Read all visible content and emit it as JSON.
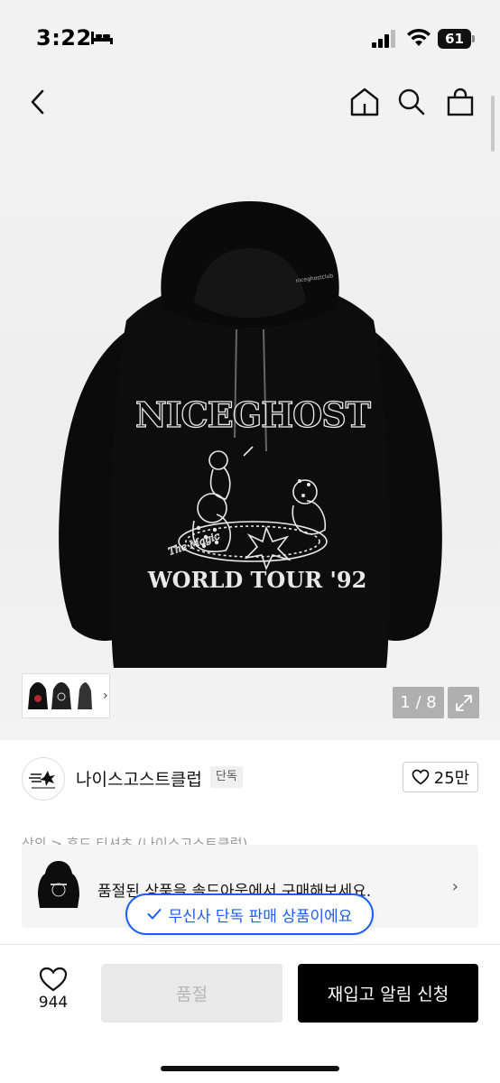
{
  "status_bar": {
    "time": "3:22",
    "battery_level": "61",
    "icons": [
      "sleep-icon",
      "signal-icon",
      "wifi-icon",
      "battery-icon"
    ]
  },
  "nav": {
    "icons": [
      "back-icon",
      "home-icon",
      "search-icon",
      "cart-icon"
    ]
  },
  "product_image": {
    "print_text": [
      "NICEGHOST",
      "The Magic",
      "WORLD TOUR '92"
    ],
    "counter": "1 / 8",
    "expand_icon": "expand-icon"
  },
  "brand": {
    "name": "나이스고스트클럽",
    "badge": "단독",
    "likes": "25만",
    "heart_icon": "heart-icon"
  },
  "breadcrumb": "상의 > 후드 티셔츠 (나이스고스트클럽)",
  "soldout_card": {
    "text": "품절된 상품을 솔드아웃에서 구매해보세요.",
    "chevron_icon": "chevron-right-icon"
  },
  "exclusive_tooltip": {
    "text": "무신사 단독 판매 상품이에요"
  },
  "bottom_bar": {
    "wish_count": "944",
    "soldout_label": "품절",
    "restock_label": "재입고 알림 신청"
  },
  "colors": {
    "accent_blue": "#1a5cff",
    "primary_black": "#000000",
    "disabled_gray": "#e9e9e9"
  }
}
